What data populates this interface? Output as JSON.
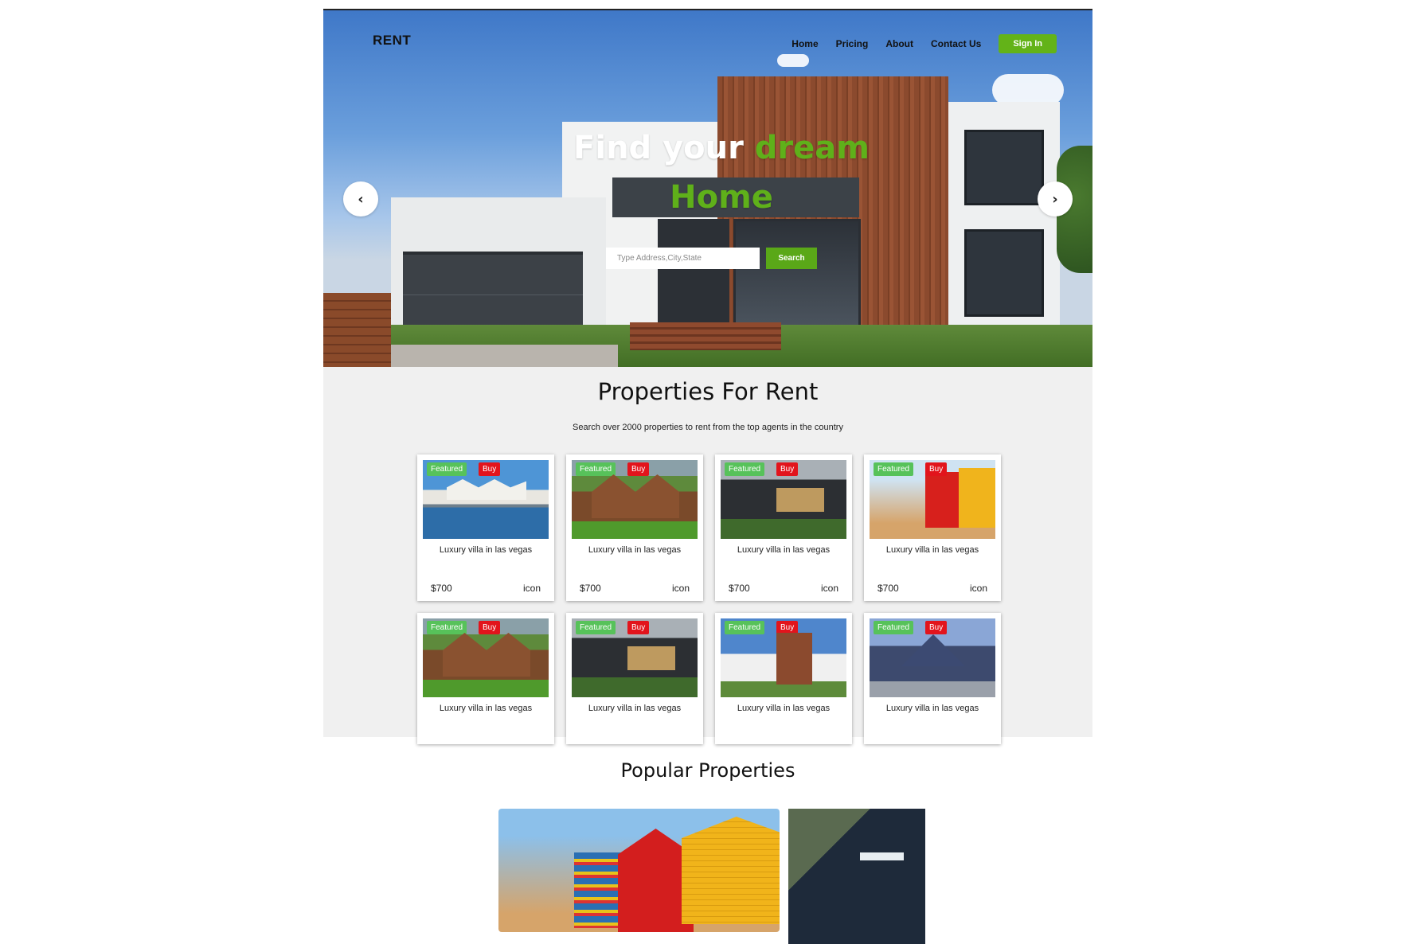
{
  "brand": "RENT",
  "nav": {
    "items": [
      "Home",
      "Pricing",
      "About",
      "Contact Us"
    ],
    "signin": "Sign In"
  },
  "hero": {
    "headline_white": "Find your",
    "headline_green_1": "dream",
    "headline_green_2": "Home",
    "search_placeholder": "Type Address,City,State",
    "search_button": "Search",
    "prev_arrow": "‹",
    "next_arrow": "›"
  },
  "properties": {
    "title": "Properties For Rent",
    "subtitle": "Search over 2000 properties to rent from the top agents in the country",
    "badge_featured": "Featured",
    "badge_buy": "Buy",
    "cards": [
      {
        "title": "Luxury villa in las vegas",
        "price": "$700",
        "icon": "icon",
        "image": "lake-house"
      },
      {
        "title": "Luxury villa in las vegas",
        "price": "$700",
        "icon": "icon",
        "image": "wood-house"
      },
      {
        "title": "Luxury villa in las vegas",
        "price": "$700",
        "icon": "icon",
        "image": "night-house"
      },
      {
        "title": "Luxury villa in las vegas",
        "price": "$700",
        "icon": "icon",
        "image": "beach-huts"
      },
      {
        "title": "Luxury villa in las vegas",
        "image": "wood-house"
      },
      {
        "title": "Luxury villa in las vegas",
        "image": "night-house"
      },
      {
        "title": "Luxury villa in las vegas",
        "image": "modern-house"
      },
      {
        "title": "Luxury villa in las vegas",
        "image": "blue-house"
      }
    ]
  },
  "popular": {
    "title": "Popular Properties"
  },
  "colors": {
    "accent_green": "#5fb01a",
    "badge_featured": "#57c25a",
    "badge_buy": "#e2141c",
    "section_bg": "#f0f0f0"
  }
}
